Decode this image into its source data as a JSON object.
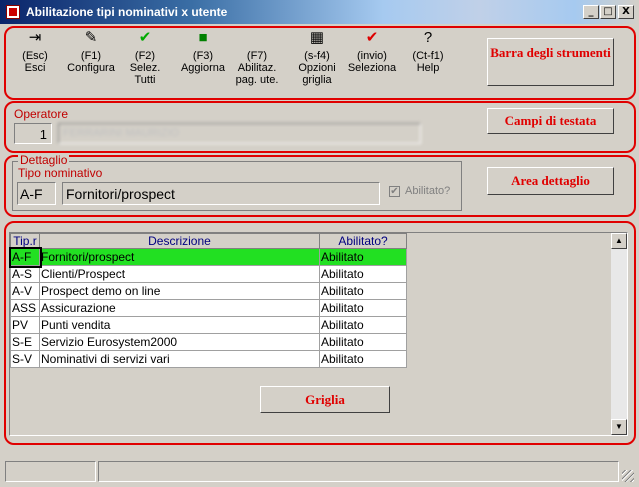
{
  "window": {
    "title": "Abilitazione tipi nominativi x utente",
    "min": "_",
    "max": "□",
    "close": "X"
  },
  "toolbar": [
    {
      "key": "(Esc)",
      "label": "Esci",
      "icon": "exit-door-icon",
      "glyph": "⇥",
      "color": "#000000"
    },
    {
      "key": "(F1)",
      "label": "Configura",
      "icon": "configure-icon",
      "glyph": "✎",
      "color": "#000000"
    },
    {
      "key": "(F2)",
      "label": "Selez.\nTutti",
      "icon": "check-all-icon",
      "glyph": "✔",
      "color": "#00aa00"
    },
    {
      "key": "(F3)",
      "label": "Aggiorna",
      "icon": "save-disk-icon",
      "glyph": "■",
      "color": "#008000"
    },
    {
      "key": "(F7)",
      "label": "Abilitaz.\npag. ute.",
      "icon": "",
      "glyph": "",
      "color": "#000000"
    },
    {
      "key": "(s-f4)",
      "label": "Opzioni\ngriglia",
      "icon": "grid-options-icon",
      "glyph": "▦",
      "color": "#000000"
    },
    {
      "key": "(invio)",
      "label": "Seleziona",
      "icon": "select-check-icon",
      "glyph": "✔",
      "color": "#dd0000"
    },
    {
      "key": "(Ct-f1)",
      "label": "Help",
      "icon": "help-icon",
      "glyph": "?",
      "color": "#000000"
    }
  ],
  "annotations": {
    "toolbar": "Barra degli strumenti",
    "header": "Campi di testata",
    "detail": "Area dettaglio",
    "grid": "Griglia"
  },
  "header": {
    "operatore_label": "Operatore",
    "operatore_code": "1",
    "operatore_name": "FERRARINI MAURIZIO"
  },
  "detail": {
    "group_label": "Dettaglio",
    "tipo_label": "Tipo nominativo",
    "tipo_code": "A-F",
    "tipo_desc": "Fornitori/prospect",
    "abilitato_label": "Abilitato?"
  },
  "grid": {
    "columns": [
      "Tip.r",
      "Descrizione",
      "Abilitato?"
    ],
    "rows": [
      [
        "A-F",
        "Fornitori/prospect",
        "Abilitato"
      ],
      [
        "A-S",
        "Clienti/Prospect",
        "Abilitato"
      ],
      [
        "A-V",
        "Prospect demo on line",
        "Abilitato"
      ],
      [
        "ASS",
        "Assicurazione",
        "Abilitato"
      ],
      [
        "PV",
        "Punti vendita",
        "Abilitato"
      ],
      [
        "S-E",
        "Servizio Eurosystem2000",
        "Abilitato"
      ],
      [
        "S-V",
        "Nominativi di servizi vari",
        "Abilitato"
      ]
    ],
    "selected_row": 0
  },
  "colors": {
    "annotation_red": "#e00000",
    "selected_row": "#22e022"
  }
}
